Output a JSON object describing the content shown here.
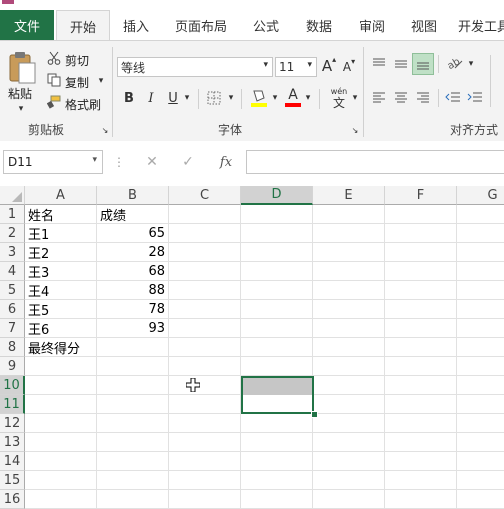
{
  "ribbon": {
    "tabs": [
      "文件",
      "开始",
      "插入",
      "页面布局",
      "公式",
      "数据",
      "审阅",
      "视图",
      "开发工具"
    ],
    "active_tab": "开始",
    "clipboard": {
      "paste": "粘贴",
      "cut": "剪切",
      "copy": "复制",
      "format_painter": "格式刷",
      "group": "剪贴板"
    },
    "font": {
      "name": "等线",
      "size": "11",
      "group": "字体",
      "bold": "B",
      "italic": "I",
      "underline": "U",
      "grow": "A",
      "shrink": "A",
      "fill_color": "#ffff00",
      "font_color": "#ff0000",
      "phonetic_top": "wén",
      "phonetic_bottom": "文"
    },
    "alignment": {
      "group": "对齐方式"
    },
    "accent_color": "#217346"
  },
  "formula_bar": {
    "name_box": "D11",
    "fx": "fx",
    "formula": ""
  },
  "grid": {
    "columns": [
      "A",
      "B",
      "C",
      "D",
      "E",
      "F",
      "G"
    ],
    "rows": [
      "1",
      "2",
      "3",
      "4",
      "5",
      "6",
      "7",
      "8",
      "9",
      "10",
      "11",
      "12",
      "13",
      "14",
      "15",
      "16"
    ],
    "cells": {
      "A1": "姓名",
      "B1": "成绩",
      "A2": "王1",
      "B2": "65",
      "A3": "王2",
      "B3": "28",
      "A4": "王3",
      "B4": "68",
      "A5": "王4",
      "B5": "88",
      "A6": "王5",
      "B6": "78",
      "A7": "王6",
      "B7": "93",
      "A8": "最终得分"
    },
    "selected_range": "D10:D11",
    "active_cell": "D11"
  }
}
